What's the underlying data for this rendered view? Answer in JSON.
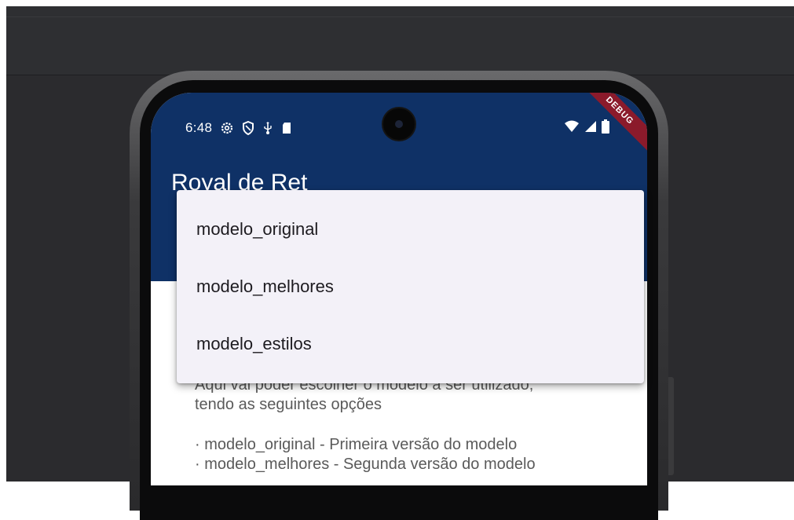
{
  "status_bar": {
    "time": "6:48",
    "left_icons": [
      "gear-icon",
      "shield-icon",
      "usb-icon",
      "sd-card-icon"
    ],
    "right_icons": [
      "wifi-icon",
      "cell-signal-icon",
      "battery-icon"
    ]
  },
  "debug_banner": "DEBUG",
  "app_bar": {
    "title_partial": "Royal de Ret"
  },
  "dropdown": {
    "options": [
      "modelo_original",
      "modelo_melhores",
      "modelo_estilos"
    ]
  },
  "body": {
    "line1": "Aqui vai poder escolher o modelo a ser utilizado,",
    "line2": "tendo as seguintes opções",
    "bullet1": "· modelo_original - Primeira versão do modelo",
    "bullet2": "· modelo_melhores - Segunda versão do modelo"
  },
  "colors": {
    "app_bar": "#0f3166",
    "debug_banner": "#8b1a2b",
    "menu_bg": "#f3f1f8",
    "background": "#2b2b2e"
  }
}
